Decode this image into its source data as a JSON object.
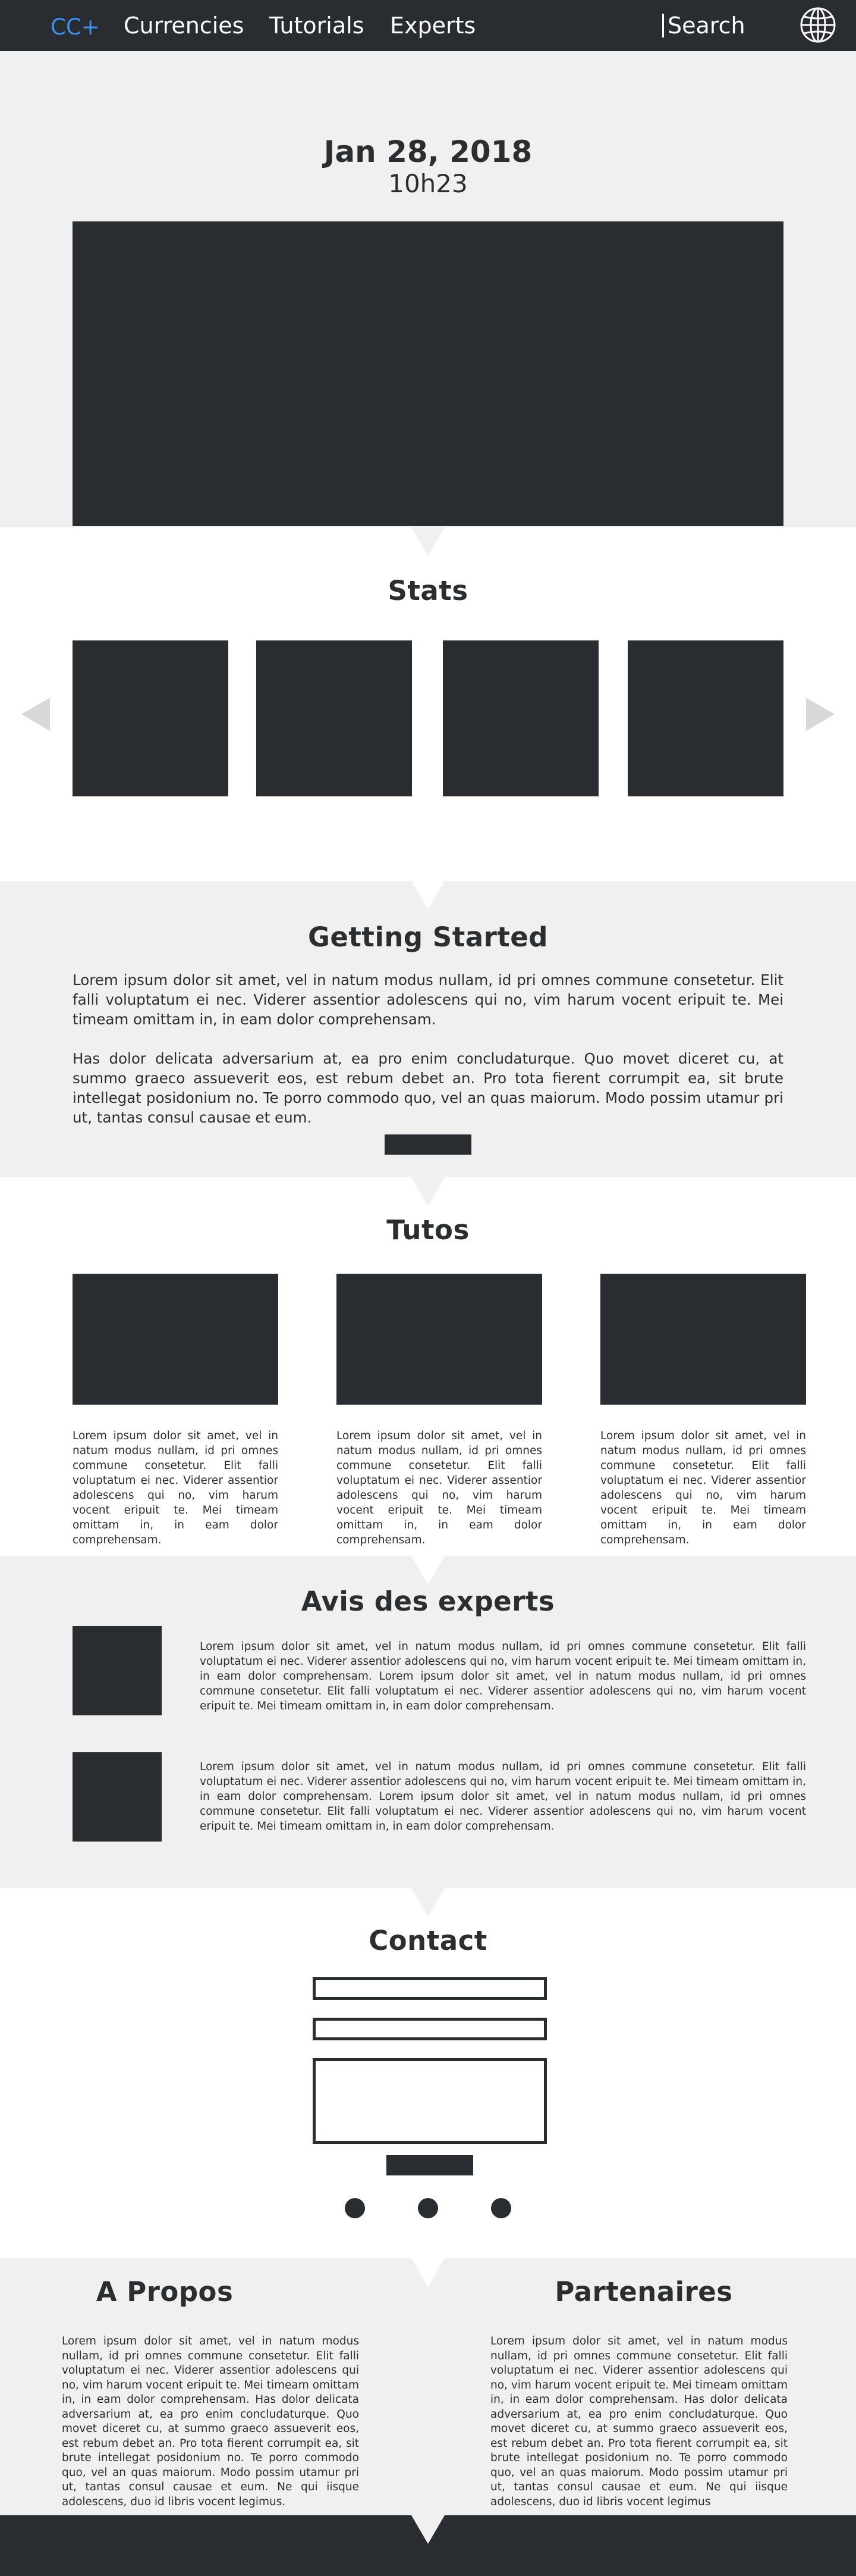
{
  "navbar": {
    "logo": "CC+",
    "links": [
      "Currencies",
      "Tutorials",
      "Experts"
    ],
    "search_label": "Search",
    "globe_icon": "globe-icon",
    "brand_color": "#3d8ef0"
  },
  "hero": {
    "date": "Jan 28, 2018",
    "time": "10h23"
  },
  "stats": {
    "title": "Stats",
    "prev_icon": "chevron-left-icon",
    "next_icon": "chevron-right-icon"
  },
  "getting_started": {
    "title": "Getting Started",
    "paragraphs": [
      "Lorem ipsum dolor sit amet, vel in natum modus nullam, id pri omnes commune consetetur. Elit falli voluptatum ei nec. Viderer assentior adolescens qui no, vim harum vocent eripuit te. Mei timeam omittam in, in eam dolor comprehensam.",
      "Has dolor delicata adversarium at, ea pro enim concludaturque. Quo movet diceret cu, at summo graeco assueverit eos, est rebum debet an. Pro tota fierent corrumpit ea, sit brute intellegat posidonium no. Te porro commodo quo, vel an quas maiorum. Modo possim utamur pri ut, tantas consul causae et eum."
    ]
  },
  "tutos": {
    "title": "Tutos",
    "items": [
      {
        "text": "Lorem ipsum dolor sit amet, vel in natum modus nullam, id pri omnes commune consetetur. Elit falli voluptatum ei nec. Viderer assentior adolescens qui no, vim harum vocent eripuit te. Mei timeam omittam in, in eam dolor comprehensam."
      },
      {
        "text": "Lorem ipsum dolor sit amet, vel in natum modus nullam, id pri omnes commune consetetur. Elit falli voluptatum ei nec. Viderer assentior adolescens qui no, vim harum vocent eripuit te. Mei timeam omittam in, in eam dolor comprehensam."
      },
      {
        "text": "Lorem ipsum dolor sit amet, vel in natum modus nullam, id pri omnes commune consetetur. Elit falli voluptatum ei nec. Viderer assentior adolescens qui no, vim harum vocent eripuit te. Mei timeam omittam in, in eam dolor comprehensam."
      }
    ]
  },
  "experts": {
    "title": "Avis des experts",
    "items": [
      {
        "text": "Lorem ipsum dolor sit amet, vel in natum modus nullam, id pri omnes commune consetetur. Elit falli voluptatum ei nec. Viderer assentior adolescens qui no, vim harum vocent eripuit te. Mei timeam omittam in, in eam dolor comprehensam. Lorem ipsum dolor sit amet, vel in natum modus nullam, id pri omnes commune consetetur. Elit falli voluptatum ei nec. Viderer assentior adolescens qui no, vim harum vocent eripuit te. Mei timeam omittam in, in eam dolor comprehensam."
      },
      {
        "text": "Lorem ipsum dolor sit amet, vel in natum modus nullam, id pri omnes commune consetetur. Elit falli voluptatum ei nec. Viderer assentior adolescens qui no, vim harum vocent eripuit te. Mei timeam omittam in, in eam dolor comprehensam. Lorem ipsum dolor sit amet, vel in natum modus nullam, id pri omnes commune consetetur. Elit falli voluptatum ei nec. Viderer assentior adolescens qui no, vim harum vocent eripuit te. Mei timeam omittam in, in eam dolor comprehensam."
      }
    ]
  },
  "contact": {
    "title": "Contact"
  },
  "about": {
    "title": "A Propos",
    "text": "Lorem ipsum dolor sit amet, vel in natum modus nullam, id pri omnes commune consetetur. Elit falli voluptatum ei nec. Viderer assentior adolescens qui no, vim harum vocent eripuit te. Mei timeam omittam in, in eam dolor comprehensam. Has dolor delicata adversarium at, ea pro enim concludaturque. Quo movet diceret cu, at summo graeco assueverit eos, est rebum debet an. Pro tota fierent corrumpit ea, sit brute intellegat posidonium no. Te porro commodo quo, vel an quas maiorum. Modo possim utamur pri ut, tantas consul causae et eum. Ne qui iisque adolescens, duo id libris vocent legimus."
  },
  "partners": {
    "title": "Partenaires",
    "text": "Lorem ipsum dolor sit amet, vel in natum modus nullam, id pri omnes commune consetetur. Elit falli voluptatum ei nec. Viderer assentior adolescens qui no, vim harum vocent eripuit te. Mei timeam omittam in, in eam dolor comprehensam. Has dolor delicata adversarium at, ea pro enim concludaturque. Quo movet diceret cu, at summo graeco assueverit eos, est rebum debet an. Pro tota fierent corrumpit ea, sit brute intellegat posidonium no. Te porro commodo quo, vel an quas maiorum. Modo possim utamur pri ut, tantas consul causae et eum. Ne qui iisque adolescens, duo id libris vocent legimus"
  },
  "colors": {
    "dark": "#292d31",
    "light_grey": "#f0f0f0",
    "white": "#ffffff",
    "accent": "#3d8ef0",
    "arrow_grey": "#d8d8d8"
  }
}
